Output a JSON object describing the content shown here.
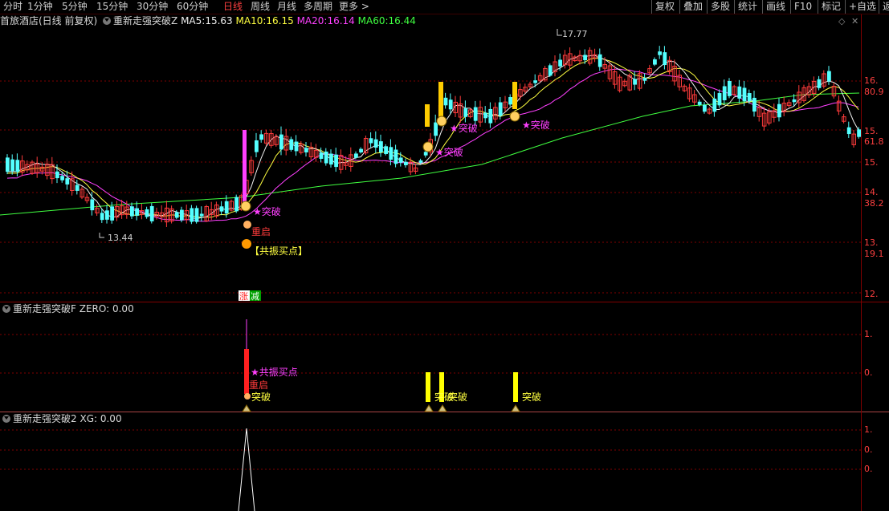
{
  "toolbar": {
    "items": [
      "分时",
      "1分钟",
      "5分钟",
      "15分钟",
      "30分钟",
      "60分钟",
      "日线",
      "周线",
      "月线",
      "多周期",
      "更多 >"
    ],
    "active": "日线",
    "right": [
      "复权",
      "叠加",
      "多股",
      "统计",
      "画线",
      "F10",
      "标记",
      "+自选",
      "返"
    ]
  },
  "main_panel": {
    "stock": "首旅酒店(日线 前复权)",
    "indicator": "重新走强突破Z",
    "ma5_label": "MA5:",
    "ma5": "15.63",
    "ma10_label": "MA10:",
    "ma10": "16.15",
    "ma20_label": "MA20:",
    "ma20": "16.14",
    "ma60_label": "MA60:",
    "ma60": "16.44",
    "high_label": "17.77",
    "low_label": "13.44",
    "tags": {
      "breakout": "★突破",
      "restart": "重启",
      "resonance": "【共振买点】",
      "zhang": "涨",
      "jian": "减"
    }
  },
  "panel2": {
    "indicator": "重新走强突破F",
    "value_label": "ZERO:",
    "value": "0.00",
    "tags": {
      "resonance": "★共振买点",
      "restart": "重启",
      "breakout": "突破"
    }
  },
  "panel3": {
    "indicator": "重新走强突破2",
    "value_label": "XG:",
    "value": "0.00"
  },
  "axis": {
    "main": [
      "16.",
      "80.9",
      "15.",
      "61.8",
      "15.",
      "14.",
      "38.2",
      "13.",
      "19.1",
      "12."
    ],
    "p2": [
      "1.",
      "0."
    ],
    "p3": [
      "1.",
      "0.",
      "0."
    ]
  },
  "colors": {
    "up": "#ff3b3b",
    "down": "#54ffff",
    "ma5": "#f0f0f0",
    "ma10": "#ffff40",
    "ma20": "#ff40ff",
    "ma60": "#40ff40",
    "grid": "#800000",
    "signal": "#ffff00"
  }
}
